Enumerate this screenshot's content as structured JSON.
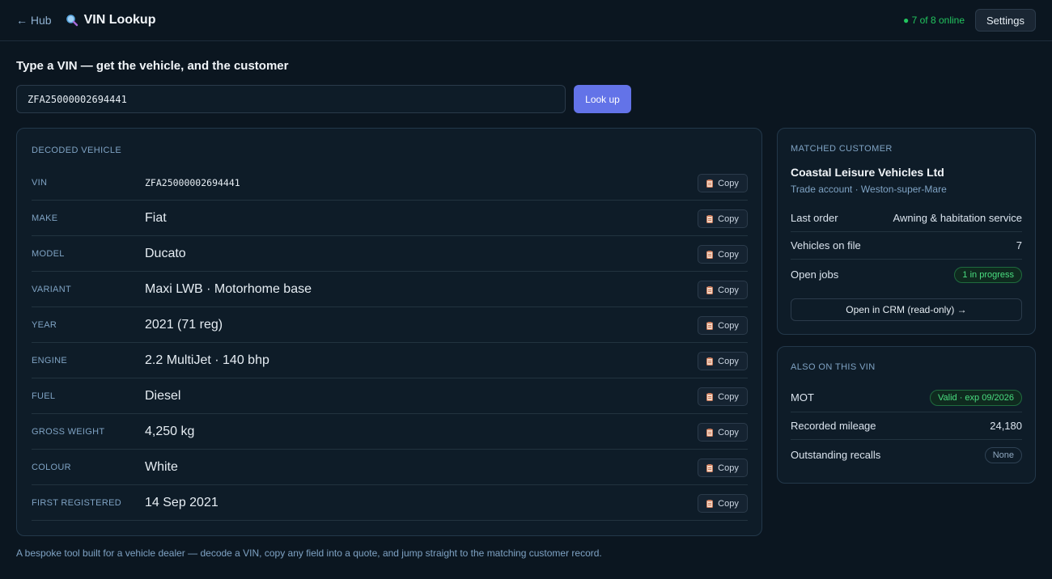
{
  "topbar": {
    "back_label": "← Hub",
    "title": "VIN Lookup",
    "online_status": "● 7 of 8 online",
    "settings_label": "Settings"
  },
  "lookup": {
    "heading": "Type a VIN — get the vehicle, and the customer",
    "vin_value": "ZFA25000002694441",
    "button_label": "Look up"
  },
  "vehicle": {
    "title": "Decoded vehicle",
    "copy_label": "Copy",
    "fields": [
      {
        "label": "VIN",
        "value": "ZFA25000002694441"
      },
      {
        "label": "Make",
        "value": "Fiat"
      },
      {
        "label": "Model",
        "value": "Ducato"
      },
      {
        "label": "Variant",
        "value": "Maxi LWB · Motorhome base"
      },
      {
        "label": "Year",
        "value": "2021 (71 reg)"
      },
      {
        "label": "Engine",
        "value": "2.2 MultiJet · 140 bhp"
      },
      {
        "label": "Fuel",
        "value": "Diesel"
      },
      {
        "label": "Gross weight",
        "value": "4,250 kg"
      },
      {
        "label": "Colour",
        "value": "White"
      },
      {
        "label": "First registered",
        "value": "14 Sep 2021"
      }
    ]
  },
  "customer": {
    "title": "Matched customer",
    "name": "Coastal Leisure Vehicles Ltd",
    "subtitle": "Trade account · Weston-super-Mare",
    "rows": {
      "last_order_label": "Last order",
      "last_order_value": "Awning & habitation service",
      "vehicles_label": "Vehicles on file",
      "vehicles_value": "7",
      "open_jobs_label": "Open jobs",
      "open_jobs_badge": "1 in progress"
    },
    "crm_button": "Open in CRM (read-only) →"
  },
  "also": {
    "title": "Also on this VIN",
    "mot_label": "MOT",
    "mot_badge": "Valid · exp 09/2026",
    "mileage_label": "Recorded mileage",
    "mileage_value": "24,180",
    "recalls_label": "Outstanding recalls",
    "recalls_badge": "None"
  },
  "footer": "A bespoke tool built for a vehicle dealer — decode a VIN, copy any field into a quote, and jump straight to the matching customer record.",
  "colors": {
    "background": "#0b1620",
    "card": "#0e1c28",
    "accent": "#6373e8",
    "online_green": "#22c55e",
    "muted_blue": "#7fa3c4"
  }
}
